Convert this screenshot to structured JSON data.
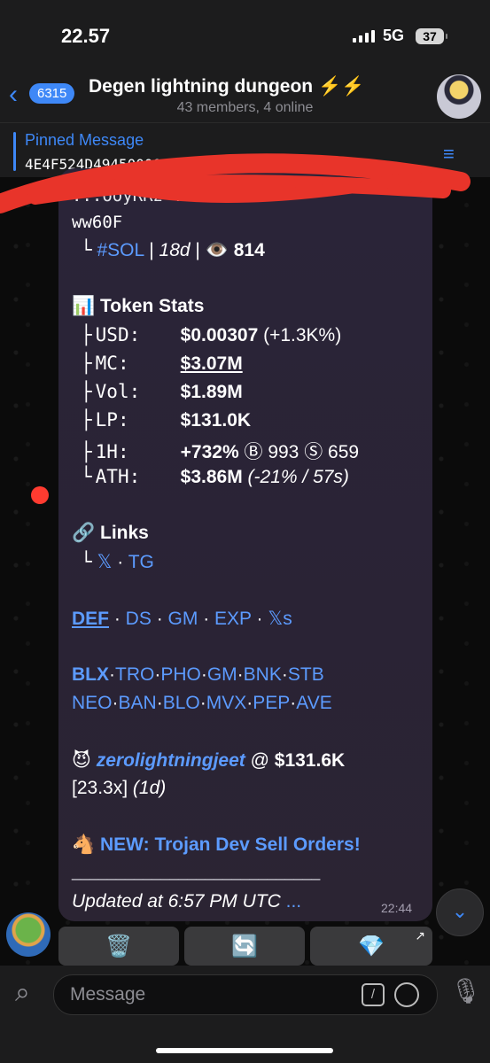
{
  "status_bar": {
    "time": "22.57",
    "network": "5G",
    "battery": "37"
  },
  "header": {
    "unread_count": "6315",
    "title": "Degen lightning dungeon ⚡️⚡️",
    "subtitle": "43 members, 4 online"
  },
  "pinned": {
    "label": "Pinned Message",
    "text": "4E4F524D4945000000000000000000000..."
  },
  "message": {
    "partial_line_1": "...ooyRRz            ..P i",
    "partial_line_2": "ww60F",
    "tag_line": {
      "prefix": "└",
      "tag": "#SOL",
      "age": "18d",
      "eye": "👁️",
      "views": "814"
    },
    "token_stats": {
      "header_icon": "📊",
      "header": "Token Stats",
      "rows": [
        {
          "branch": "├",
          "key": "USD:",
          "value": "$0.00307",
          "extra": "(+1.3K%)"
        },
        {
          "branch": "├",
          "key": "MC:",
          "value": "$3.07M",
          "extra": ""
        },
        {
          "branch": "├",
          "key": "Vol:",
          "value": "$1.89M",
          "extra": ""
        },
        {
          "branch": "├",
          "key": "LP:",
          "value": "$131.0K",
          "extra": ""
        },
        {
          "branch": "├",
          "key": "1H:",
          "value": "+732%",
          "extra": "Ⓑ 993 Ⓢ 659"
        },
        {
          "branch": "└",
          "key": "ATH:",
          "value": "$3.86M",
          "extra": "(-21% / 57s)"
        }
      ]
    },
    "links": {
      "header_icon": "🔗",
      "header": "Links",
      "branch": "└",
      "items": [
        "𝕏",
        "TG"
      ]
    },
    "nav_links": [
      "DEF",
      "DS",
      "GM",
      "EXP",
      "𝕏s"
    ],
    "bots_row_1": [
      "BLX",
      "TRO",
      "PHO",
      "GM",
      "BNK",
      "STB"
    ],
    "bots_row_2": [
      "NEO",
      "BAN",
      "BLO",
      "MVX",
      "PEP",
      "AVE"
    ],
    "caller": {
      "icon": "😈",
      "name": "zerolightningjeet",
      "at": "@",
      "price": "$131.6K",
      "multiple": "[23.3x]",
      "age": "(1d)"
    },
    "promo": {
      "icon": "🐴",
      "text": "NEW: Trojan Dev Sell Orders!"
    },
    "divider": "____________________________",
    "updated": "Updated at 6:57 PM UTC",
    "updated_more": "...",
    "time": "22:44"
  },
  "keyboard": {
    "buttons": [
      "🗑️",
      "🔄",
      "💎"
    ]
  },
  "input": {
    "placeholder": "Message"
  }
}
